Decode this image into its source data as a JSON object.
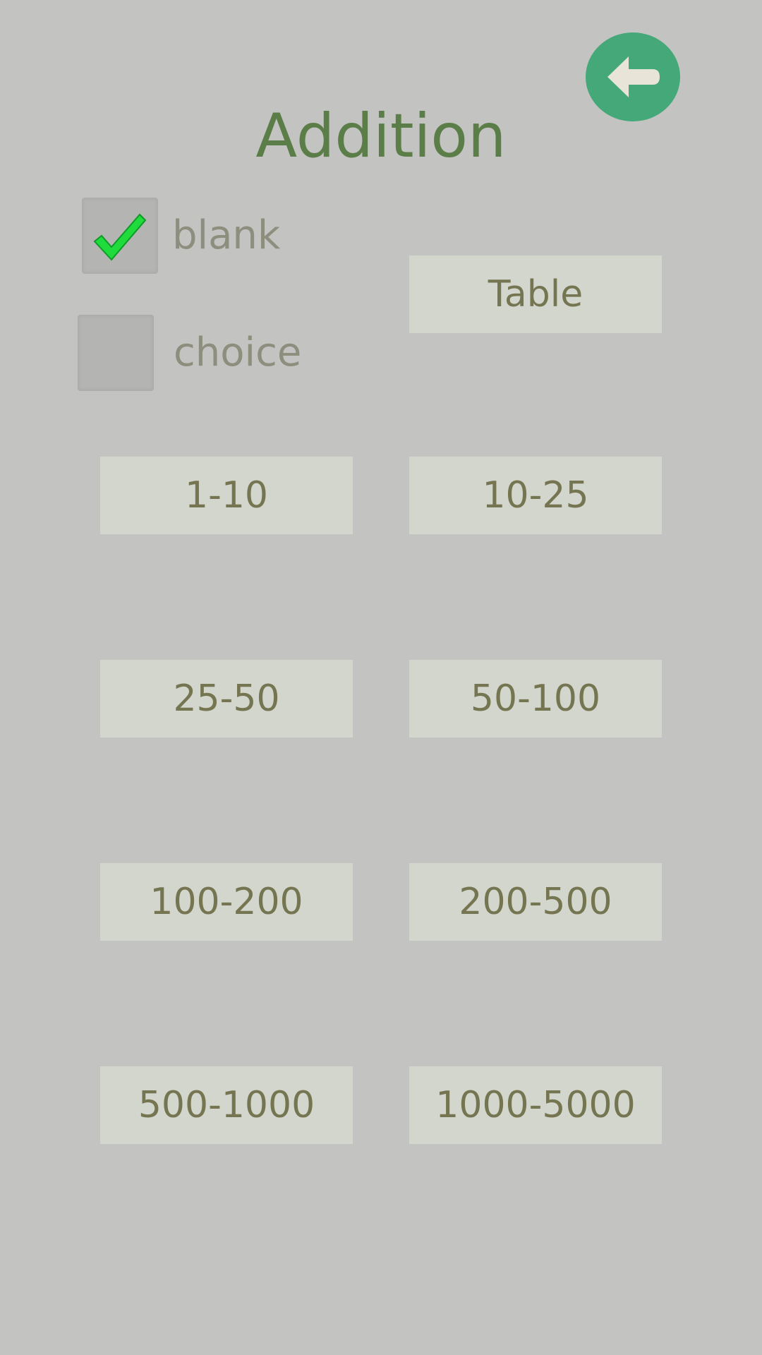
{
  "header": {
    "title": "Addition",
    "back_icon": "arrow-left-icon",
    "accent_color": "#44a878"
  },
  "options": {
    "blank": {
      "label": "blank",
      "checked": true
    },
    "choice": {
      "label": "choice",
      "checked": false
    }
  },
  "buttons": {
    "table": "Table",
    "ranges": [
      "1-10",
      "10-25",
      "25-50",
      "50-100",
      "100-200",
      "200-500",
      "500-1000",
      "1000-5000"
    ]
  }
}
